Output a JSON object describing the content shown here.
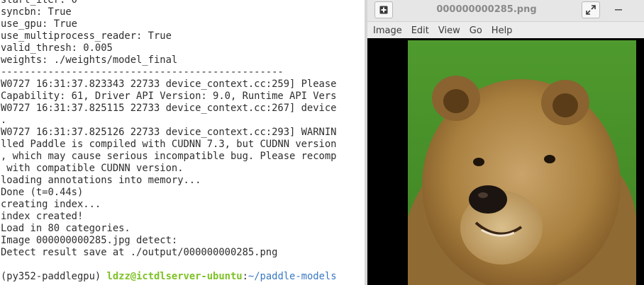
{
  "terminal": {
    "lines": [
      "start_iter: 0",
      "syncbn: True",
      "use_gpu: True",
      "use_multiprocess_reader: True",
      "valid_thresh: 0.005",
      "weights: ./weights/model_final",
      "------------------------------------------------",
      "W0727 16:31:37.823343 22733 device_context.cc:259] Please",
      "Capability: 61, Driver API Version: 9.0, Runtime API Vers",
      "W0727 16:31:37.825115 22733 device_context.cc:267] device",
      ".",
      "W0727 16:31:37.825126 22733 device_context.cc:293] WARNIN",
      "lled Paddle is compiled with CUDNN 7.3, but CUDNN version",
      ", which may cause serious incompatible bug. Please recomp",
      " with compatible CUDNN version.",
      "loading annotations into memory...",
      "Done (t=0.44s)",
      "creating index...",
      "index created!",
      "Load in 80 categories.",
      "Image 000000000285.jpg detect:",
      "Detect result save at ./output/000000000285.png",
      ""
    ],
    "prompt": {
      "env": "(py352-paddlegpu) ",
      "user_host": "ldzz@ictdlserver-ubuntu",
      "sep": ":",
      "path": "~/paddle-models"
    }
  },
  "viewer": {
    "title": "000000000285.png",
    "menu": [
      "Image",
      "Edit",
      "View",
      "Go",
      "Help"
    ],
    "photo_subject": "brown bear on grass"
  },
  "colors": {
    "terminal_text": "#2e2e2e",
    "prompt_user": "#7ec225",
    "prompt_path": "#3a78c3"
  }
}
